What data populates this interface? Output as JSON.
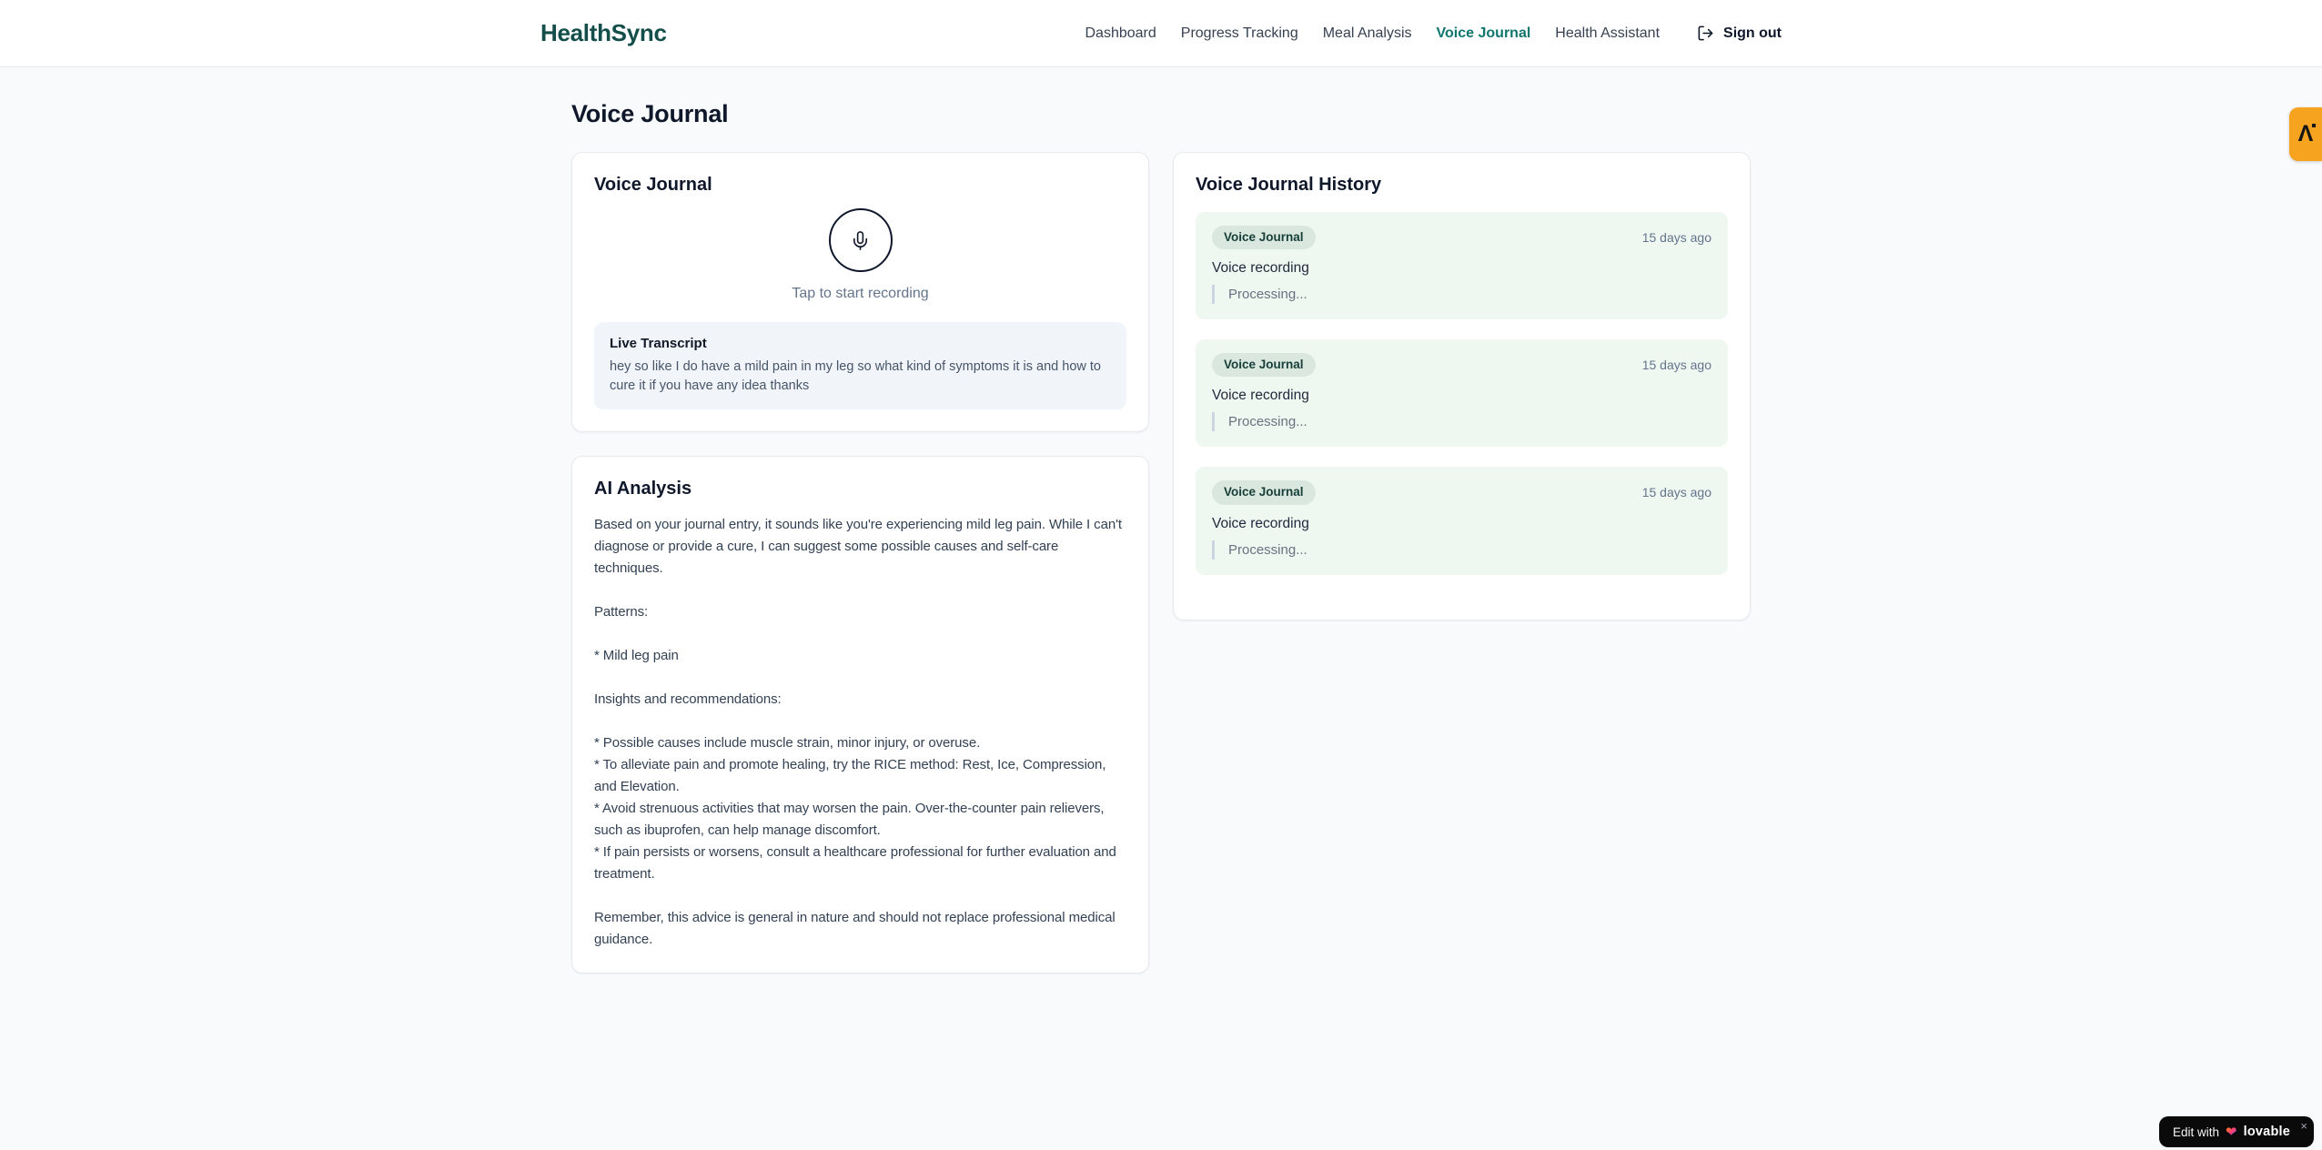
{
  "brand": {
    "name": "HealthSync"
  },
  "nav": {
    "items": [
      {
        "label": "Dashboard",
        "active": false
      },
      {
        "label": "Progress Tracking",
        "active": false
      },
      {
        "label": "Meal Analysis",
        "active": false
      },
      {
        "label": "Voice Journal",
        "active": true
      },
      {
        "label": "Health Assistant",
        "active": false
      }
    ],
    "sign_out_label": "Sign out"
  },
  "page": {
    "title": "Voice Journal"
  },
  "recorder_card": {
    "title": "Voice Journal",
    "tap_hint": "Tap to start recording",
    "transcript_title": "Live Transcript",
    "transcript_text": "hey so like I do have a mild pain in my leg so what kind of symptoms it is and how to cure it if you have any idea thanks"
  },
  "analysis_card": {
    "title": "AI Analysis",
    "body": "Based on your journal entry, it sounds like you're experiencing mild leg pain. While I can't diagnose or provide a cure, I can suggest some possible causes and self-care techniques.\n\nPatterns:\n\n* Mild leg pain\n\nInsights and recommendations:\n\n* Possible causes include muscle strain, minor injury, or overuse.\n* To alleviate pain and promote healing, try the RICE method: Rest, Ice, Compression, and Elevation.\n* Avoid strenuous activities that may worsen the pain. Over-the-counter pain relievers, such as ibuprofen, can help manage discomfort.\n* If pain persists or worsens, consult a healthcare professional for further evaluation and treatment.\n\nRemember, this advice is general in nature and should not replace professional medical guidance."
  },
  "history_card": {
    "title": "Voice Journal History",
    "entries": [
      {
        "badge": "Voice Journal",
        "time": "15 days ago",
        "text": "Voice recording",
        "status": "Processing..."
      },
      {
        "badge": "Voice Journal",
        "time": "15 days ago",
        "text": "Voice recording",
        "status": "Processing..."
      },
      {
        "badge": "Voice Journal",
        "time": "15 days ago",
        "text": "Voice recording",
        "status": "Processing..."
      }
    ]
  },
  "overlays": {
    "side_badge_glyph": "Λ",
    "edit_with_label": "Edit with",
    "lovable_brand": "lovable",
    "heart_icon": "❤",
    "close_label": "×"
  },
  "colors": {
    "brand_logo": "#134e4a",
    "nav_active": "#0f766e",
    "page_background": "#f8fafc",
    "entry_background": "#eff7f1",
    "badge_background": "#dae7de",
    "badge_text": "#163f39",
    "transcript_background": "#f1f5f9",
    "side_badge": "#f6a41f",
    "lovable_badge": "#0a0a0a"
  }
}
